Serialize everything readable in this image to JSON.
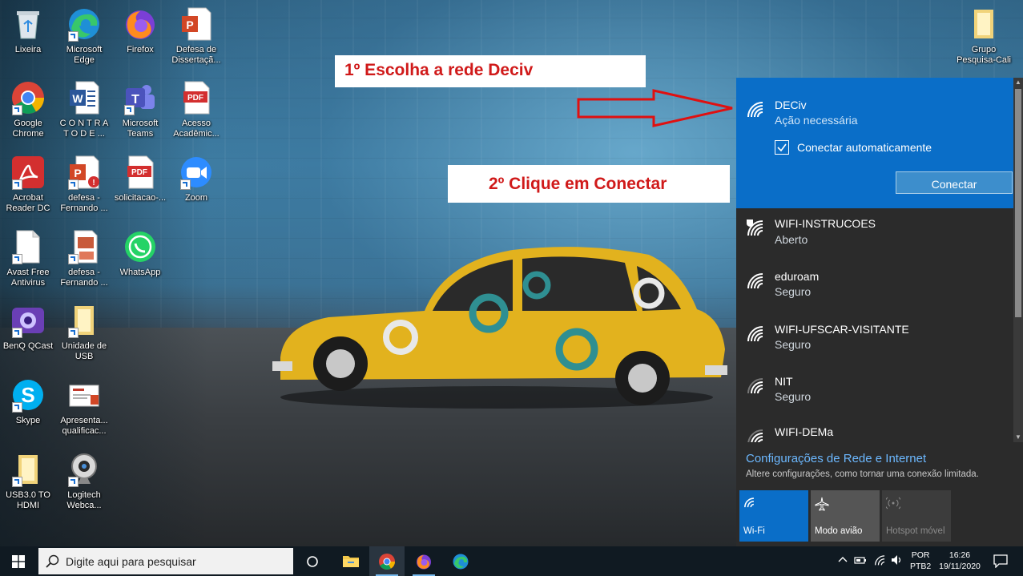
{
  "desktop": {
    "icons": [
      {
        "label": "Lixeira"
      },
      {
        "label": "Microsoft Edge"
      },
      {
        "label": "Firefox"
      },
      {
        "label": "Defesa de Dissertaçã..."
      },
      {
        "label": "Google Chrome"
      },
      {
        "label": "C O N T R A T O   D E ..."
      },
      {
        "label": "Microsoft Teams"
      },
      {
        "label": "Acesso Acadêmic..."
      },
      {
        "label": "Acrobat Reader DC"
      },
      {
        "label": "defesa - Fernando ..."
      },
      {
        "label": "solicitacao-..."
      },
      {
        "label": "Zoom"
      },
      {
        "label": "Avast Free Antivirus"
      },
      {
        "label": "defesa - Fernando ..."
      },
      {
        "label": "WhatsApp"
      },
      {
        "label": "BenQ QCast"
      },
      {
        "label": "Unidade de USB"
      },
      {
        "label": "Skype"
      },
      {
        "label": "Apresenta... qualificac..."
      },
      {
        "label": "USB3.0 TO HDMI"
      },
      {
        "label": "Logitech Webca..."
      },
      {
        "label": "Grupo Pesquisa-Cali"
      }
    ]
  },
  "annotations": {
    "step1": "1º Escolha a rede Deciv",
    "step2": "2º Clique em Conectar"
  },
  "network_flyout": {
    "selected": {
      "name": "DECiv",
      "status": "Ação necessária",
      "auto_connect_label": "Conectar automaticamente",
      "auto_connect_checked": true,
      "connect_label": "Conectar"
    },
    "networks": [
      {
        "name": "WIFI-INSTRUCOES",
        "status": "Aberto"
      },
      {
        "name": "eduroam",
        "status": "Seguro"
      },
      {
        "name": "WIFI-UFSCAR-VISITANTE",
        "status": "Seguro"
      },
      {
        "name": "NIT",
        "status": "Seguro"
      },
      {
        "name": "WIFI-DEMa",
        "status": ""
      }
    ],
    "settings_link": "Configurações de Rede e Internet",
    "settings_sub": "Altere configurações, como tornar uma conexão limitada.",
    "tiles": [
      {
        "label": "Wi-Fi",
        "active": true
      },
      {
        "label": "Modo avião",
        "active": false
      },
      {
        "label": "Hotspot móvel",
        "active": false
      }
    ]
  },
  "taskbar": {
    "search_placeholder": "Digite aqui para pesquisar",
    "language": "POR",
    "keyboard": "PTB2",
    "time": "16:26",
    "date": "19/11/2020"
  },
  "colors": {
    "accent": "#0a6ec8",
    "annotation_red": "#d01a1a",
    "flyout_bg": "#2b2b2b",
    "link": "#6cb8ff"
  }
}
